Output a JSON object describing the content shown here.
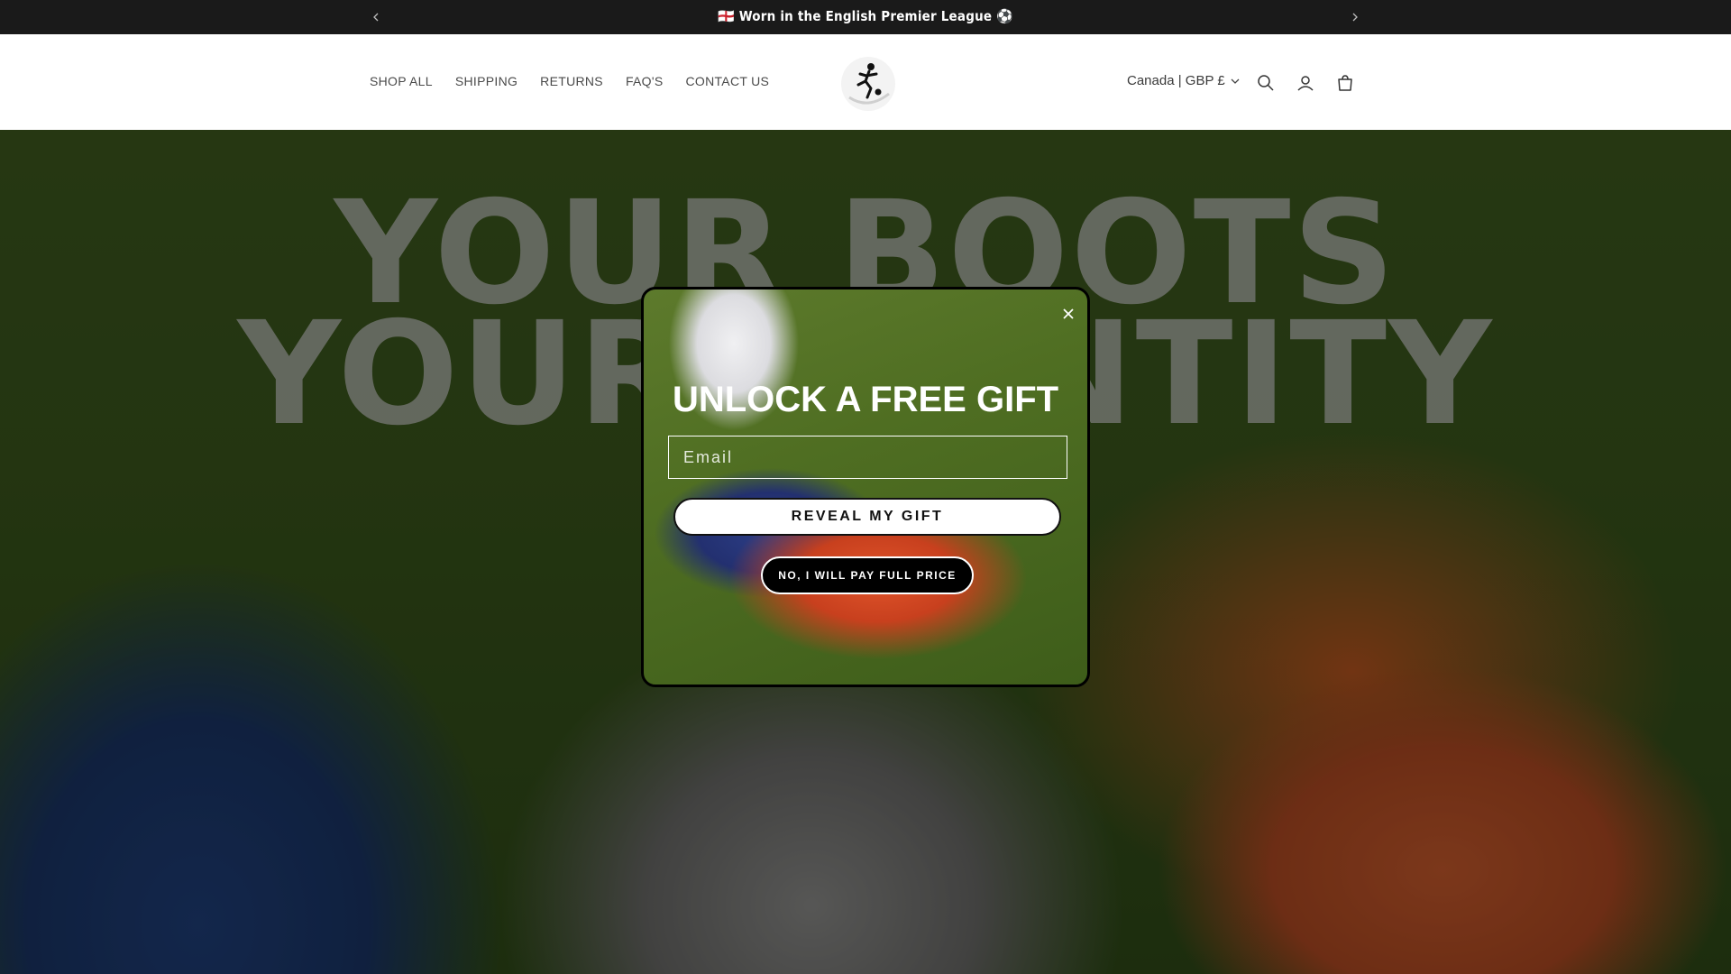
{
  "announcement": {
    "message": "🏴󠁧󠁢󠁥󠁮󠁧󠁿 Worn in the English Premier League ⚽",
    "prev_icon": "chevron-left-icon",
    "next_icon": "chevron-right-icon"
  },
  "header": {
    "nav": [
      {
        "label": "SHOP ALL"
      },
      {
        "label": "SHIPPING"
      },
      {
        "label": "RETURNS"
      },
      {
        "label": "FAQ'S"
      },
      {
        "label": "CONTACT US"
      }
    ],
    "logo_icon": "footballer-logo-icon",
    "currency": "Canada | GBP £",
    "icons": [
      "search-icon",
      "account-icon",
      "cart-icon"
    ]
  },
  "hero": {
    "line1": "YOUR BOOTS",
    "line2": "YOUR IDENTITY"
  },
  "popup": {
    "title": "UNLOCK A FREE GIFT",
    "email_placeholder": "Email",
    "reveal_label": "REVEAL MY GIFT",
    "decline_label": "NO, I WILL PAY FULL PRICE",
    "close_icon": "close-icon"
  }
}
